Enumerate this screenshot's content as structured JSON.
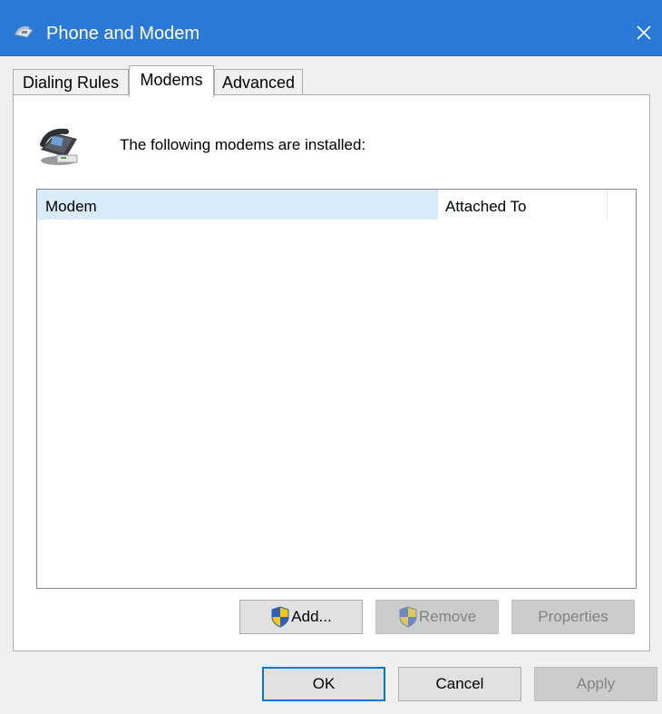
{
  "window": {
    "title": "Phone and Modem",
    "app_icon": "phone-modem-icon",
    "close_icon": "close-icon",
    "titlebar_color": "#2b79d6"
  },
  "tabs": [
    {
      "label": "Dialing Rules",
      "active": false
    },
    {
      "label": "Modems",
      "active": true
    },
    {
      "label": "Advanced",
      "active": false
    }
  ],
  "modems_panel": {
    "intro_text": "The following modems are installed:",
    "icon": "modem-telephone-icon",
    "columns": [
      "Modem",
      "Attached To"
    ],
    "rows": [],
    "buttons": {
      "add": {
        "label": "Add...",
        "icon": "uac-shield-icon",
        "enabled": true
      },
      "remove": {
        "label": "Remove",
        "icon": "uac-shield-icon",
        "enabled": false
      },
      "properties": {
        "label": "Properties",
        "enabled": false
      }
    }
  },
  "footer": {
    "ok": "OK",
    "cancel": "Cancel",
    "apply": "Apply"
  },
  "colors": {
    "accent": "#0078d7",
    "column_header_highlight": "#d9eaf8"
  }
}
